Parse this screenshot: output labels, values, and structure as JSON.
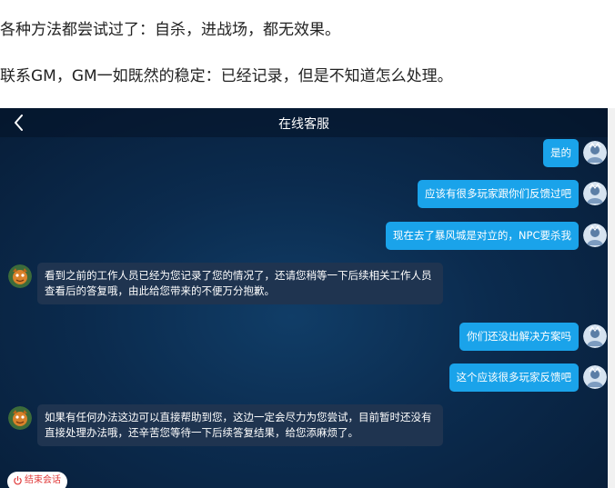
{
  "article": {
    "paragraph1": "各种方法都尝试过了：自杀，进战场，都无效果。",
    "paragraph2": "联系GM，GM一如既然的稳定：已经记录，但是不知道怎么处理。"
  },
  "chat": {
    "title": "在线客服",
    "messages": [
      {
        "side": "out",
        "text": "是的"
      },
      {
        "side": "out",
        "text": "应该有很多玩家跟你们反馈过吧"
      },
      {
        "side": "out",
        "text": "现在去了暴风城是对立的，NPC要杀我"
      },
      {
        "side": "in",
        "line1": "看到之前的工作人员已经为您记录了您的情况了，还请您稍等一下后续相关工作人员",
        "line2": "查看后的答复哦，由此给您带来的不便万分抱歉。"
      },
      {
        "side": "out",
        "text": "你们还没出解决方案吗"
      },
      {
        "side": "out",
        "text": "这个应该很多玩家反馈吧"
      },
      {
        "side": "in",
        "line1": "如果有任何办法这边可以直接帮助到您，这边一定会尽力为您尝试，目前暂时还没有",
        "line2": "直接处理办法哦，还辛苦您等待一下后续答复结果，给您添麻烦了。"
      }
    ],
    "end_button_label": "结束会话"
  },
  "colors": {
    "user_bubble": "#1aa3ea",
    "agent_bubble": "#1f3450",
    "chat_background": "#0b2b4e",
    "end_button_text": "#e03a3a"
  },
  "icons": {
    "back": "chevron-left-icon",
    "user_avatar": "user-avatar-icon",
    "agent_avatar": "agent-avatar-icon",
    "end": "power-icon"
  }
}
